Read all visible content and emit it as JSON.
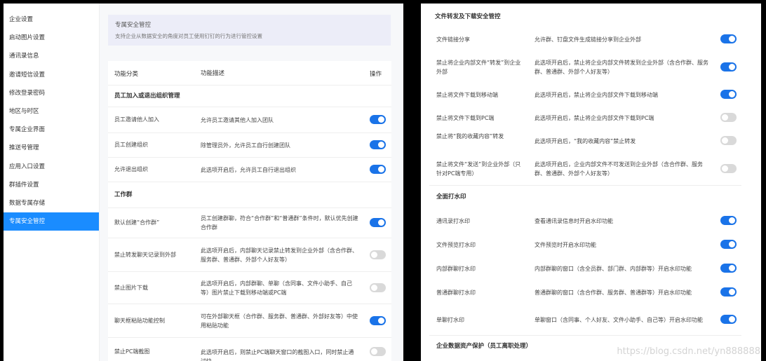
{
  "sidebar": {
    "items": [
      {
        "label": "企业设置",
        "active": false
      },
      {
        "label": "启动图片设置",
        "active": false
      },
      {
        "label": "通讯录信息",
        "active": false
      },
      {
        "label": "邀请短信设置",
        "active": false
      },
      {
        "label": "修改登录密码",
        "active": false
      },
      {
        "label": "地区与时区",
        "active": false
      },
      {
        "label": "专属企业界面",
        "active": false
      },
      {
        "label": "推送号管理",
        "active": false
      },
      {
        "label": "应用入口设置",
        "active": false
      },
      {
        "label": "群插件设置",
        "active": false
      },
      {
        "label": "数据专属存储",
        "active": false
      },
      {
        "label": "专属安全管控",
        "active": true
      }
    ]
  },
  "banner": {
    "title": "专属安全管控",
    "desc": "支持企业从数据安全的角度对员工使用钉钉的行为进行管控设置"
  },
  "table": {
    "headers": {
      "category": "功能分类",
      "description": "功能描述",
      "action": "操作"
    },
    "sections": [
      {
        "title": "员工加入或退出组织管理"
      },
      {
        "title": "工作群"
      }
    ],
    "rows": [
      {
        "name": "员工邀请他人加入",
        "desc": "允许员工邀请其他人加入团队",
        "on": true
      },
      {
        "name": "员工创建组织",
        "desc": "除管理员外，允许员工自行创建团队",
        "on": true
      },
      {
        "name": "允许退出组织",
        "desc": "此选项开启后，允许员工自行退出组织",
        "on": true
      },
      {
        "name": "默认创建“合作群”",
        "desc": "员工创建群聊，符合“合作群”和“普通群”条件时，默认优先创建合作群",
        "on": true
      },
      {
        "name": "禁止转发聊天记录到外部",
        "desc": "此选项开启后，内部聊天记录禁止转发到企业外部（含合作群、服务群、普通群、外部个人好友等）",
        "on": false
      },
      {
        "name": "禁止图片下载",
        "desc": "此选项开启后，内部群聊、单聊（含同事、文件小助手、自己等）图片禁止下载到移动端或PC端",
        "on": false
      },
      {
        "name": "聊天框粘贴功能控制",
        "desc": "可在外部聊天框（合作群、服务群、普通群、外部好友等）中使用粘贴功能",
        "on": true
      },
      {
        "name": "禁止PC端截图",
        "desc": "此选项开启后，则禁止PC端聊天窗口的截图入口，同时禁止通过快",
        "on": false
      }
    ]
  },
  "right": {
    "title": "文件转发及下载安全管控",
    "rows": [
      {
        "name": "文件链接分享",
        "desc": "允许群、钉盘文件生成链接分享到企业外部",
        "on": true
      },
      {
        "name": "禁止将企业内部文件“转发”到企业外部",
        "desc": "此选项开启后，禁止将企业内部文件转发到企业外部（含合作群、服务群、普通群、外部个人好友等）",
        "on": true
      },
      {
        "name": "禁止将文件下载到移动端",
        "desc": "此选项开启后，禁止将企业内部文件下载到移动端",
        "on": true
      },
      {
        "name": "禁止将文件下载到PC端",
        "desc": "此选项开启后，禁止将企业内部文件下载到PC端",
        "on": false
      },
      {
        "name": "禁止将“我的收藏内容”转发",
        "desc": "此选项开启后，“我的收藏内容”禁止转发",
        "on": false
      },
      {
        "name": "禁止将文件“发送”到企业外部（只针对PC端专用）",
        "desc": "此选项开启后，企业内部文件不可发送到企业外部（含合作群、服务群、普通群、外部个人好友等）",
        "on": false
      }
    ],
    "section2": "全面打水印",
    "rows2": [
      {
        "name": "通讯录打水印",
        "desc": "查看通讯录信息时开启水印功能",
        "on": true
      },
      {
        "name": "文件预览打水印",
        "desc": "文件预览时开启水印功能",
        "on": true
      },
      {
        "name": "内部群聊打水印",
        "desc": "内部群聊的窗口（含全员群、部门群、内部群等）开启水印功能",
        "on": true
      },
      {
        "name": "普通群聊打水印",
        "desc": "普通群聊的窗口（含合作群、服务群、普通群等）开启水印功能",
        "on": true
      },
      {
        "name": "单聊打水印",
        "desc": "单聊窗口（含同事、个人好友、文件小助手、自己等）开启水印功能",
        "on": true
      }
    ],
    "section3": "企业数据资产保护（员工离职处理）"
  },
  "watermark": "https://blog.csdn.net/yn888888",
  "colors": {
    "accent": "#1a73e8",
    "sidebar_active": "#1a8cff",
    "toggle_off": "#d9d9d9"
  }
}
